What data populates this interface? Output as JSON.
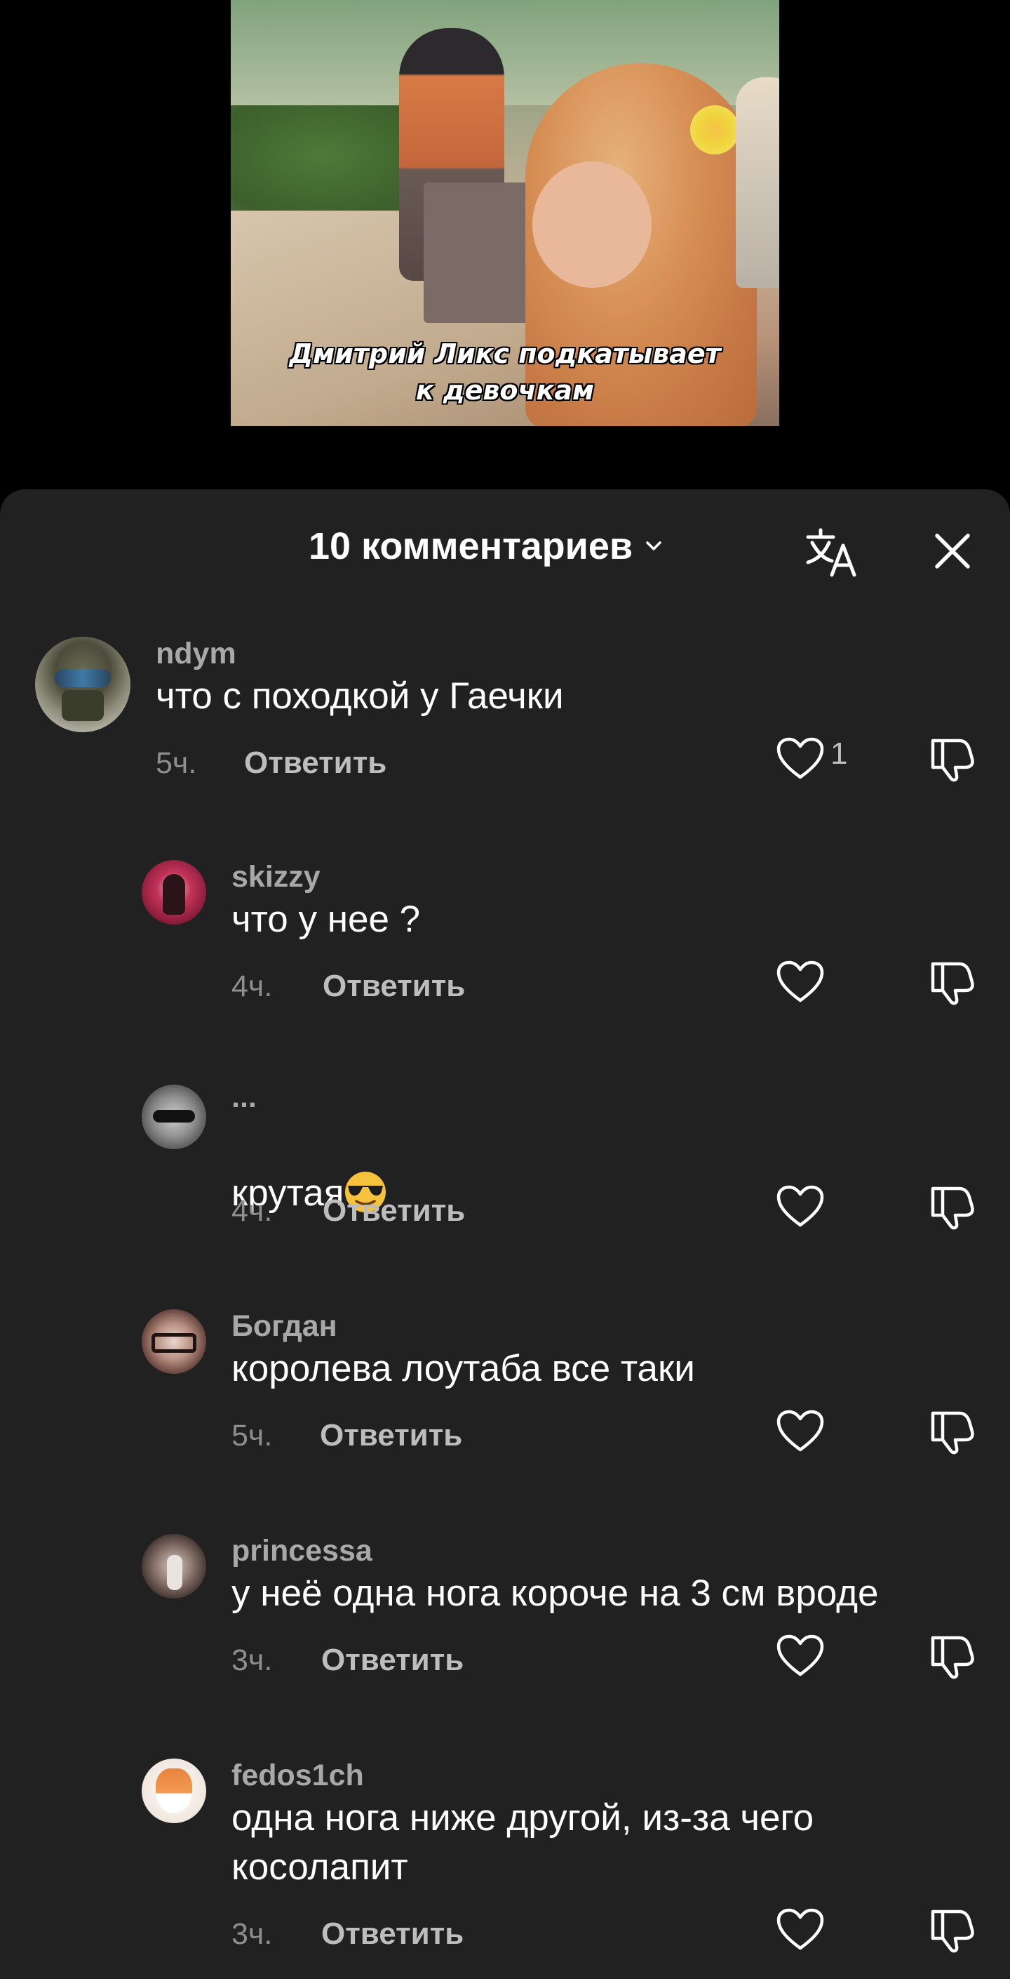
{
  "video": {
    "caption_line1": "Дмитрий Ликс подкатывает",
    "caption_line2": "к девочкам"
  },
  "header": {
    "title": "10 комментариев",
    "chevron_icon": "chevron-down-icon",
    "translate_icon": "translate-icon",
    "close_icon": "close-icon"
  },
  "comments": [
    {
      "username": "ndym",
      "text": "что с походкой у Гаечки",
      "time": "5ч.",
      "reply": "Ответить",
      "likes": "1"
    },
    {
      "username": "skizzy",
      "text": "что у нее ?",
      "time": "4ч.",
      "reply": "Ответить",
      "likes": ""
    },
    {
      "username": "...",
      "text": "крутая",
      "emoji": "😎",
      "time": "4ч.",
      "reply": "Ответить",
      "likes": ""
    },
    {
      "username": "Богдан",
      "text": "королева лоутаба все таки",
      "time": "5ч.",
      "reply": "Ответить",
      "likes": ""
    },
    {
      "username": "princessa",
      "text": "у неё одна нога короче на 3 см вроде",
      "time": "3ч.",
      "reply": "Ответить",
      "likes": ""
    },
    {
      "username": "fedos1ch",
      "text": "одна нога ниже другой, из-за чего\nкосолапит",
      "time": "3ч.",
      "reply": "Ответить",
      "likes": ""
    }
  ],
  "colors": {
    "sheet_bg": "#212121",
    "username": "#a8a8a8",
    "meta": "#8e8e8e",
    "text": "#ffffff"
  }
}
